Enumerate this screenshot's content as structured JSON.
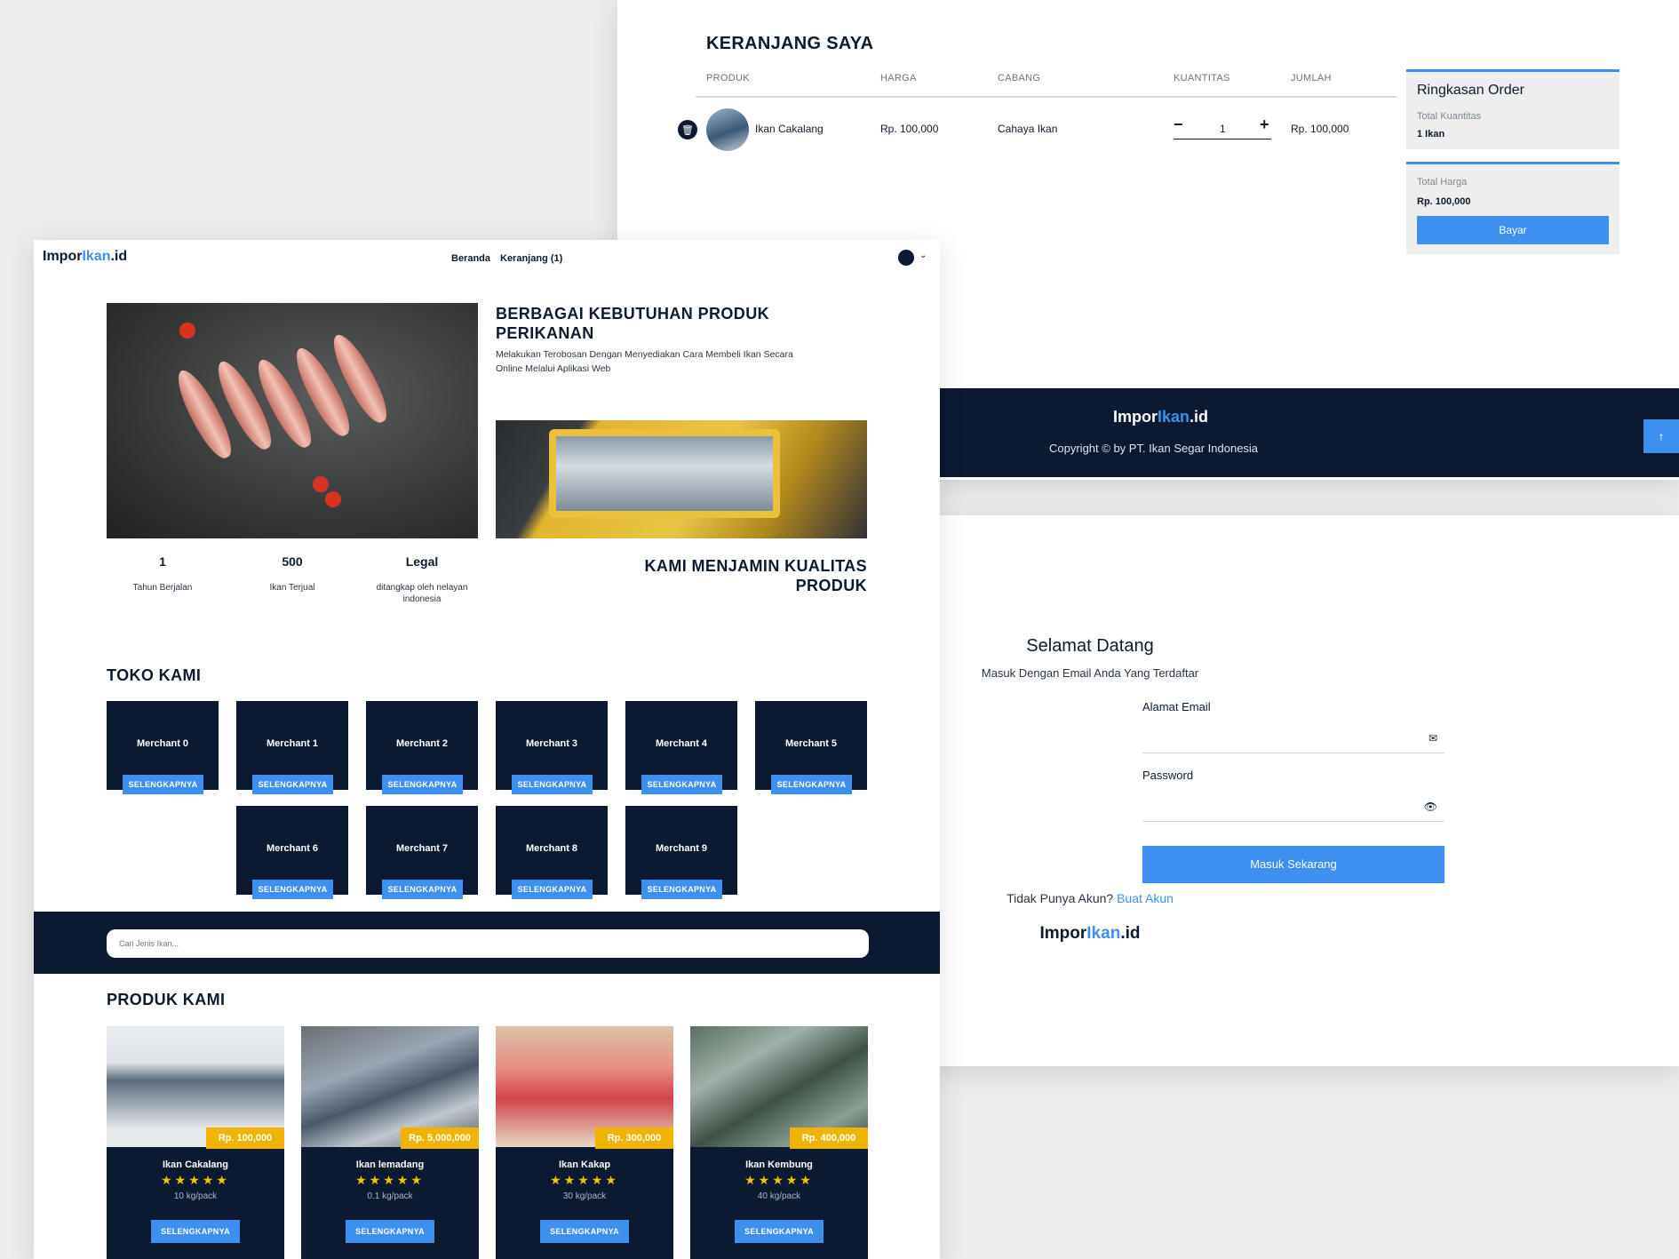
{
  "cart": {
    "title": "KERANJANG SAYA",
    "columns": [
      "PRODUK",
      "HARGA",
      "CABANG",
      "KUANTITAS",
      "JUMLAH"
    ],
    "item": {
      "name": "Ikan Cakalang",
      "price": "Rp. 100,000",
      "branch": "Cahaya Ikan",
      "qty": "1",
      "total": "Rp. 100,000"
    },
    "summary": {
      "title": "Ringkasan Order",
      "qty_label": "Total Kuantitas",
      "qty_value": "1 Ikan",
      "price_label": "Total Harga",
      "price_value": "Rp. 100,000",
      "pay_label": "Bayar"
    }
  },
  "footer": {
    "logo_a": "Impor",
    "logo_b": "Ikan",
    "logo_c": ".id",
    "copyright": "Copyright © by PT. Ikan Segar Indonesia"
  },
  "login": {
    "title": "Selamat Datang",
    "subtitle": "Masuk Dengan Email Anda Yang Terdaftar",
    "email_label": "Alamat Email",
    "password_label": "Password",
    "button": "Masuk Sekarang",
    "no_account": "Tidak Punya Akun?",
    "signup_link": "Buat Akun",
    "logo_a": "Impor",
    "logo_b": "Ikan",
    "logo_c": ".id"
  },
  "nav": {
    "logo_a": "Impor",
    "logo_b": "Ikan",
    "logo_c": ".id",
    "home": "Beranda",
    "cart": "Keranjang (1)"
  },
  "hero": {
    "title": "BERBAGAI KEBUTUHAN PRODUK PERIKANAN",
    "subtitle": "Melakukan Terobosan Dengan Menyediakan Cara Membeli Ikan Secara Online Melalui Aplikasi Web",
    "quality": "KAMI MENJAMIN KUALITAS PRODUK",
    "stats": [
      {
        "value": "1",
        "label": "Tahun Berjalan"
      },
      {
        "value": "500",
        "label": "Ikan Terjual"
      },
      {
        "value": "Legal",
        "label": "ditangkap oleh nelayan indonesia"
      }
    ]
  },
  "stores": {
    "title": "TOKO KAMI",
    "button": "SELENGKAPNYA",
    "merchants": [
      "Merchant 0",
      "Merchant 1",
      "Merchant 2",
      "Merchant 3",
      "Merchant 4",
      "Merchant 5",
      "Merchant 6",
      "Merchant 7",
      "Merchant 8",
      "Merchant 9"
    ]
  },
  "search": {
    "placeholder": "Cari Jenis Ikan..."
  },
  "products": {
    "title": "PRODUK KAMI",
    "button": "SELENGKAPNYA",
    "stars": "★★★★★",
    "items": [
      {
        "name": "Ikan Cakalang",
        "price": "Rp. 100,000",
        "unit": "10 kg/pack"
      },
      {
        "name": "Ikan lemadang",
        "price": "Rp. 5,000,000",
        "unit": "0.1 kg/pack"
      },
      {
        "name": "Ikan Kakap",
        "price": "Rp. 300,000",
        "unit": "30 kg/pack"
      },
      {
        "name": "Ikan Kembung",
        "price": "Rp. 400,000",
        "unit": "40 kg/pack"
      }
    ]
  },
  "colors": {
    "navy": "#0b1a30",
    "accent": "#3d8ff0",
    "price_badge": "#f0b400"
  }
}
